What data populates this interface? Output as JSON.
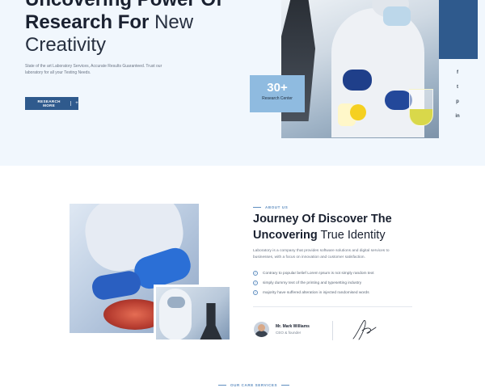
{
  "hero": {
    "title_line1": "Uncovering Power Of",
    "title_line2_bold": "Research For",
    "title_line2_thin": " New",
    "title_line3": "Creativity",
    "description": "State of the art Laboratory Services, Accurate Results Guaranteed. Trust our laboratory for all your Testing Needs.",
    "button_label": "RESEARCH MORE",
    "button_icon": "+"
  },
  "badge": {
    "number": "30+",
    "label": "Research Center"
  },
  "social": [
    {
      "name": "facebook-icon",
      "glyph": "f"
    },
    {
      "name": "twitter-icon",
      "glyph": "t"
    },
    {
      "name": "pinterest-icon",
      "glyph": "p"
    },
    {
      "name": "linkedin-icon",
      "glyph": "in"
    }
  ],
  "about": {
    "eyebrow": "ABOUT US",
    "title_line1": "Journey Of Discover The",
    "title_line2_bold": "Uncovering",
    "title_line2_thin": " True Identity",
    "description": "Laboratory is a company that provides software solutions and digital services to businesses, with a focus on innovation and customer satisfaction.",
    "checks": [
      "Contrary to popular belief Lorem Ipsum is not simply random text",
      "simply dummy text of the printing and typesetting industry",
      "majority have suffered alteration in injected randomised words"
    ],
    "person_name": "Mr. Mark Williams",
    "person_role": "CEO & founder"
  },
  "services": {
    "eyebrow": "OUR CARE SERVICES"
  },
  "colors": {
    "brand": "#2f5a8d",
    "badge": "#8fbbe0",
    "hero_bg": "#f1f7fd",
    "accent": "#5f8ec0"
  }
}
